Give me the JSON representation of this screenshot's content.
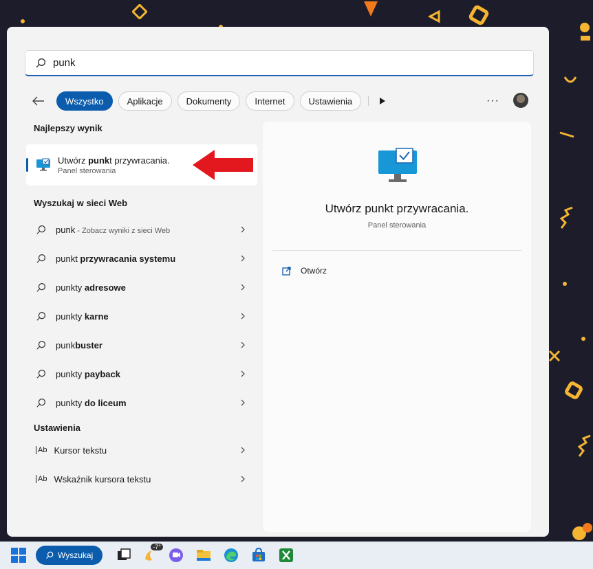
{
  "search": {
    "value": "punk",
    "placeholder": ""
  },
  "filters": {
    "items": [
      "Wszystko",
      "Aplikacje",
      "Dokumenty",
      "Internet",
      "Ustawienia"
    ],
    "more_label": "···"
  },
  "best_match": {
    "section_title": "Najlepszy wynik",
    "title_pre": "Utwórz ",
    "title_bold": "punk",
    "title_post": "t przywracania.",
    "subtitle": "Panel sterowania"
  },
  "web": {
    "section_title": "Wyszukaj w sieci Web",
    "items": [
      {
        "prefix": "punk",
        "bold": "",
        "suffix": " - Zobacz wyniki z sieci Web"
      },
      {
        "prefix": "punkt ",
        "bold": "przywracania systemu",
        "suffix": ""
      },
      {
        "prefix": "punkty ",
        "bold": "adresowe",
        "suffix": ""
      },
      {
        "prefix": "punkty ",
        "bold": "karne",
        "suffix": ""
      },
      {
        "prefix": "punk",
        "bold": "buster",
        "suffix": ""
      },
      {
        "prefix": "punkty ",
        "bold": "payback",
        "suffix": ""
      },
      {
        "prefix": "punkty ",
        "bold": "do liceum",
        "suffix": ""
      }
    ]
  },
  "settings": {
    "section_title": "Ustawienia",
    "icon_label": "Ab",
    "items": [
      "Kursor tekstu",
      "Wskaźnik kursora tekstu"
    ]
  },
  "detail": {
    "title": "Utwórz punkt przywracania.",
    "subtitle": "Panel sterowania",
    "open_label": "Otwórz"
  },
  "taskbar": {
    "search_label": "Wyszukaj",
    "weather_temp": "-7°"
  },
  "colors": {
    "accent": "#0b5cad",
    "annotation_arrow": "#e3181f"
  }
}
